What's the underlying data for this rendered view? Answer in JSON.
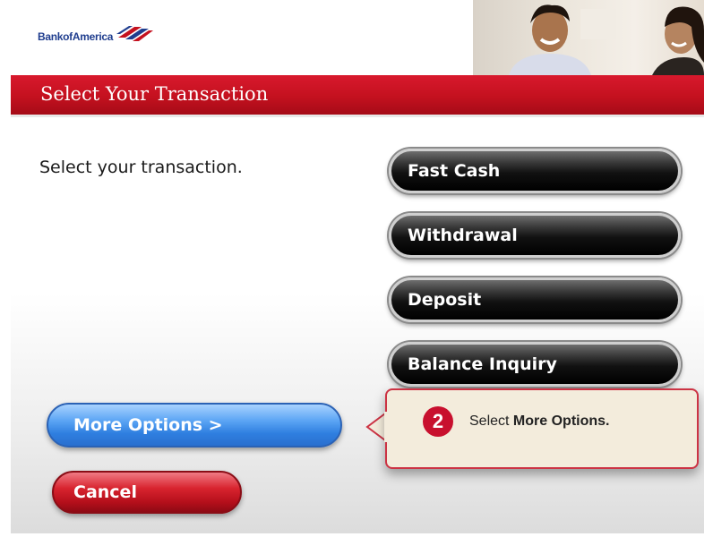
{
  "brand": {
    "name": "Bank of America",
    "logo_text": "BankofAmerica",
    "colors": {
      "red": "#c4111f",
      "blue": "#1f3d8e"
    }
  },
  "header": {
    "title": "Select Your Transaction"
  },
  "main": {
    "prompt": "Select your transaction.",
    "transactions": [
      {
        "label": "Fast Cash"
      },
      {
        "label": "Withdrawal"
      },
      {
        "label": "Deposit"
      },
      {
        "label": "Balance Inquiry"
      }
    ],
    "more_options_label": "More Options >",
    "cancel_label": "Cancel"
  },
  "callout": {
    "step_number": "2",
    "text_prefix": "Select ",
    "text_bold": "More Options."
  }
}
